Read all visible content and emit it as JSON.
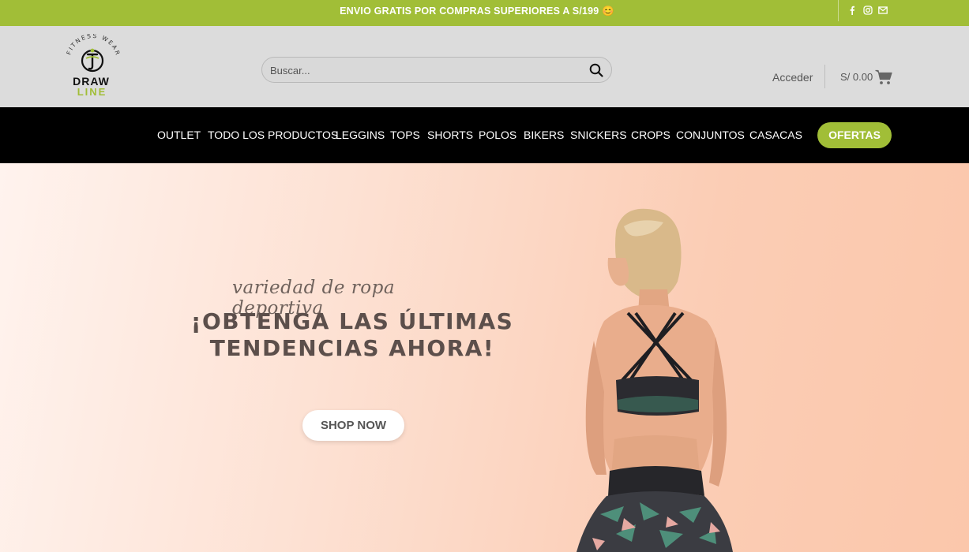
{
  "topbar": {
    "promo": "ENVIO GRATIS POR COMPRAS SUPERIORES A S/199 😊",
    "social": [
      "facebook-icon",
      "instagram-icon",
      "mail-icon"
    ],
    "color": "#a1be37"
  },
  "header": {
    "logo": {
      "top_text": "FITNESS WEAR",
      "line1": "DRAW",
      "line2": "LINE"
    },
    "search": {
      "placeholder": "Buscar..."
    },
    "account": "Acceder",
    "cart_total": "S/ 0.00",
    "background": "#dcdcdc"
  },
  "nav": {
    "items": [
      "OUTLET",
      "TODO LOS PRODUCTOS",
      "LEGGINS",
      "TOPS",
      "SHORTS",
      "POLOS",
      "BIKERS",
      "SNICKERS",
      "CROPS",
      "CONJUNTOS",
      "CASACAS"
    ],
    "cta": "OFERTAS",
    "background": "#000000"
  },
  "hero": {
    "tagline": "variedad de ropa deportiva",
    "headline_line1": "¡OBTENGA LAS ÚLTIMAS",
    "headline_line2": "TENDENCIAS AHORA!",
    "button": "SHOP NOW"
  }
}
